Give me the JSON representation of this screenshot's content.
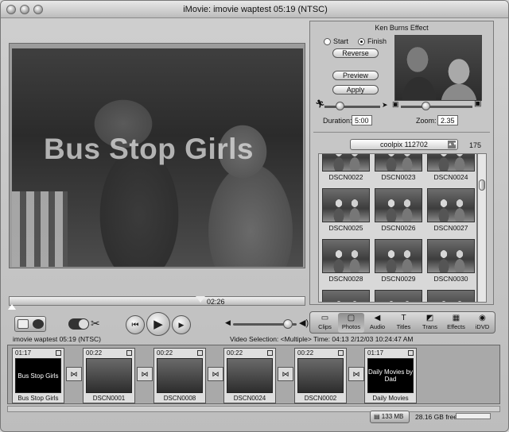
{
  "window": {
    "title": "iMovie: imovie waptest  05:19 (NTSC)"
  },
  "monitor": {
    "overlay_title": "Bus Stop Girls",
    "playhead_time": "02:26"
  },
  "ken_burns": {
    "title": "Ken Burns Effect",
    "start_label": "Start",
    "finish_label": "Finish",
    "selected": "Finish",
    "reverse_label": "Reverse",
    "preview_label": "Preview",
    "apply_label": "Apply",
    "duration_label": "Duration:",
    "duration_value": "5:00",
    "zoom_label": "Zoom:",
    "zoom_value": "2.35"
  },
  "photos": {
    "album": "coolpix 112702",
    "count": "175",
    "items": [
      "DSCN0022",
      "DSCN0023",
      "DSCN0024",
      "DSCN0025",
      "DSCN0026",
      "DSCN0027",
      "DSCN0028",
      "DSCN0029",
      "DSCN0030",
      "",
      "",
      ""
    ]
  },
  "panes": [
    {
      "label": "Clips",
      "icon": "clips-icon"
    },
    {
      "label": "Photos",
      "icon": "photos-icon",
      "active": true
    },
    {
      "label": "Audio",
      "icon": "audio-icon"
    },
    {
      "label": "Titles",
      "icon": "titles-icon"
    },
    {
      "label": "Trans",
      "icon": "trans-icon"
    },
    {
      "label": "Effects",
      "icon": "effects-icon"
    },
    {
      "label": "iDVD",
      "icon": "idvd-icon"
    }
  ],
  "info": {
    "project": "imovie waptest  05:19 (NTSC)",
    "selection": "Video Selection: <Multiple>  Time: 04:13  2/12/03 10:24:47 AM"
  },
  "clips": [
    {
      "duration": "01:17",
      "name": "Bus Stop Girls",
      "frame_text": "Bus Stop Girls",
      "black": true
    },
    {
      "duration": "00:22",
      "name": "DSCN0001",
      "frame_text": ""
    },
    {
      "duration": "00:22",
      "name": "DSCN0008",
      "frame_text": ""
    },
    {
      "duration": "00:22",
      "name": "DSCN0024",
      "frame_text": ""
    },
    {
      "duration": "00:22",
      "name": "DSCN0002",
      "frame_text": ""
    },
    {
      "duration": "01:17",
      "name": "Daily Movies",
      "frame_text": "Daily Movies by Dad",
      "black": true
    }
  ],
  "status": {
    "trash_label": "133 MB",
    "free_space": "28.16 GB free"
  }
}
